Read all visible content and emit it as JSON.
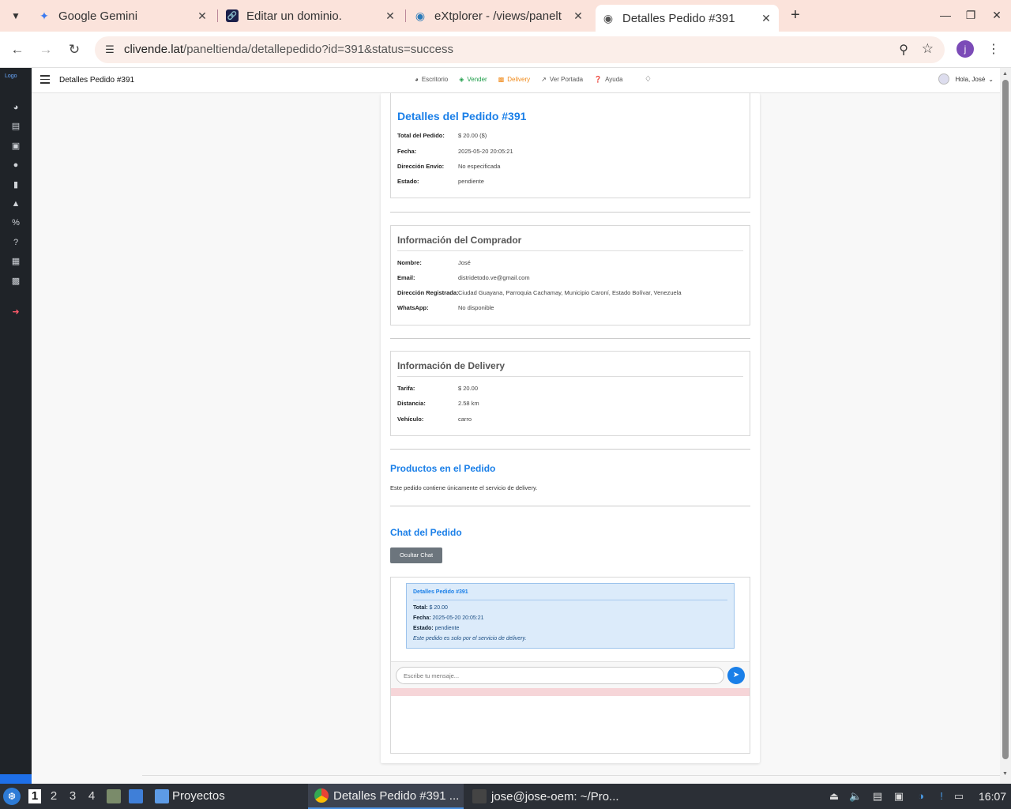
{
  "browser": {
    "tabs": [
      {
        "title": "Google Gemini",
        "icon": "gemini-icon"
      },
      {
        "title": "Editar un dominio.",
        "icon": "link-icon"
      },
      {
        "title": "eXtplorer - /views/panelt",
        "icon": "globe-icon"
      },
      {
        "title": "Detalles Pedido #391",
        "icon": "globe-icon"
      }
    ],
    "url_host": "clivende.lat",
    "url_path": "/paneltienda/detallepedido?id=391&status=success",
    "profile_initial": "j"
  },
  "app": {
    "logo_alt": "Logo",
    "page_title": "Detalles Pedido #391",
    "menu": [
      {
        "label": "Escritorio",
        "icon": "dashboard-icon"
      },
      {
        "label": "Vender",
        "icon": "money-icon"
      },
      {
        "label": "Delivery",
        "icon": "truck-icon"
      },
      {
        "label": "Ver Portada",
        "icon": "external-link-icon"
      },
      {
        "label": "Ayuda",
        "icon": "help-icon"
      }
    ],
    "user_greeting": "Hola, José",
    "colors": {
      "accent": "#1a7fe8",
      "sidebar": "#1f2328",
      "vender": "#1f9d4a",
      "delivery": "#f08a1a"
    }
  },
  "order": {
    "title": "Detalles del Pedido #391",
    "fields": [
      {
        "label": "Total del Pedido:",
        "value": "$ 20.00 ($)"
      },
      {
        "label": "Fecha:",
        "value": "2025-05-20 20:05:21"
      },
      {
        "label": "Dirección Envío:",
        "value": "No especificada"
      },
      {
        "label": "Estado:",
        "value": "pendiente"
      }
    ]
  },
  "buyer": {
    "title": "Información del Comprador",
    "fields": [
      {
        "label": "Nombre:",
        "value": "José"
      },
      {
        "label": "Email:",
        "value": "distridetodo.ve@gmail.com"
      },
      {
        "label": "Dirección Registrada:",
        "value": "Ciudad Guayana, Parroquia Cachamay, Municipio Caroní, Estado Bolívar, Venezuela"
      },
      {
        "label": "WhatsApp:",
        "value": "No disponible"
      }
    ]
  },
  "delivery": {
    "title": "Información de Delivery",
    "fields": [
      {
        "label": "Tarifa:",
        "value": "$ 20.00"
      },
      {
        "label": "Distancia:",
        "value": "2.58 km"
      },
      {
        "label": "Vehículo:",
        "value": "carro"
      }
    ]
  },
  "products": {
    "title": "Productos en el Pedido",
    "text": "Este pedido contiene únicamente el servicio de delivery."
  },
  "chat": {
    "title": "Chat del Pedido",
    "toggle_label": "Ocultar Chat",
    "message": {
      "title": "Detalles Pedido #391",
      "total_label": "Total:",
      "total_value": "$ 20.00",
      "date_label": "Fecha:",
      "date_value": "2025-05-20 20:05:21",
      "status_label": "Estado:",
      "status_value": "pendiente",
      "note": "Este pedido es solo por el servicio de delivery."
    },
    "input_placeholder": "Escribe tu mensaje..."
  },
  "taskbar": {
    "workspaces": [
      "1",
      "2",
      "3",
      "4"
    ],
    "folder_label": "Proyectos",
    "apps": [
      {
        "title": "Detalles Pedido #391 ...",
        "icon": "chrome-icon"
      },
      {
        "title": "jose@jose-oem: ~/Pro...",
        "icon": "terminal-icon"
      }
    ],
    "clock": "16:07"
  }
}
